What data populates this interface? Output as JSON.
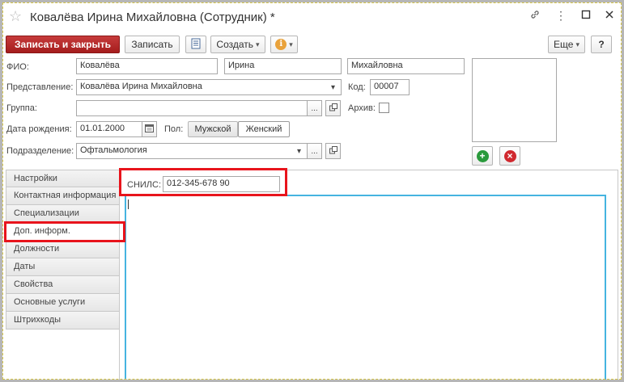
{
  "window": {
    "title": "Ковалёва Ирина Михайловна (Сотрудник) *"
  },
  "toolbar": {
    "save_close": "Записать и закрыть",
    "save": "Записать",
    "create": "Создать",
    "more": "Еще",
    "help": "?"
  },
  "form": {
    "fio_label": "ФИО:",
    "last_name": "Ковалёва",
    "first_name": "Ирина",
    "middle_name": "Михайловна",
    "presentation_label": "Представление:",
    "presentation": "Ковалёва Ирина Михайловна",
    "code_label": "Код:",
    "code": "00007",
    "group_label": "Группа:",
    "group": "",
    "archive_label": "Архив:",
    "birth_label": "Дата рождения:",
    "birth_date": "01.01.2000",
    "gender_label": "Пол:",
    "gender_male": "Мужской",
    "gender_female": "Женский",
    "department_label": "Подразделение:",
    "department": "Офтальмология",
    "ellipsis": "..."
  },
  "tabs": [
    "Настройки",
    "Контактная информация",
    "Специализации",
    "Доп. информ.",
    "Должности",
    "Даты",
    "Свойства",
    "Основные услуги",
    "Штрихкоды"
  ],
  "active_tab": "Доп. информ.",
  "extra_info": {
    "snils_label": "СНИЛС:",
    "snils": "012-345-678 90"
  },
  "colors": {
    "primary_button": "#b22424",
    "highlight": "#e8141c",
    "focus_border": "#45b4e0",
    "add_icon": "#2a9a3c",
    "remove_icon": "#d0282e"
  },
  "icons": {
    "favorite": "star-icon",
    "link": "link-icon",
    "menu": "more-vertical-icon",
    "maximize": "maximize-icon",
    "close": "close-icon",
    "report": "report-icon",
    "info": "info-icon",
    "calendar": "calendar-icon",
    "open": "open-icon",
    "add_photo": "add-icon",
    "remove_photo": "remove-icon"
  }
}
